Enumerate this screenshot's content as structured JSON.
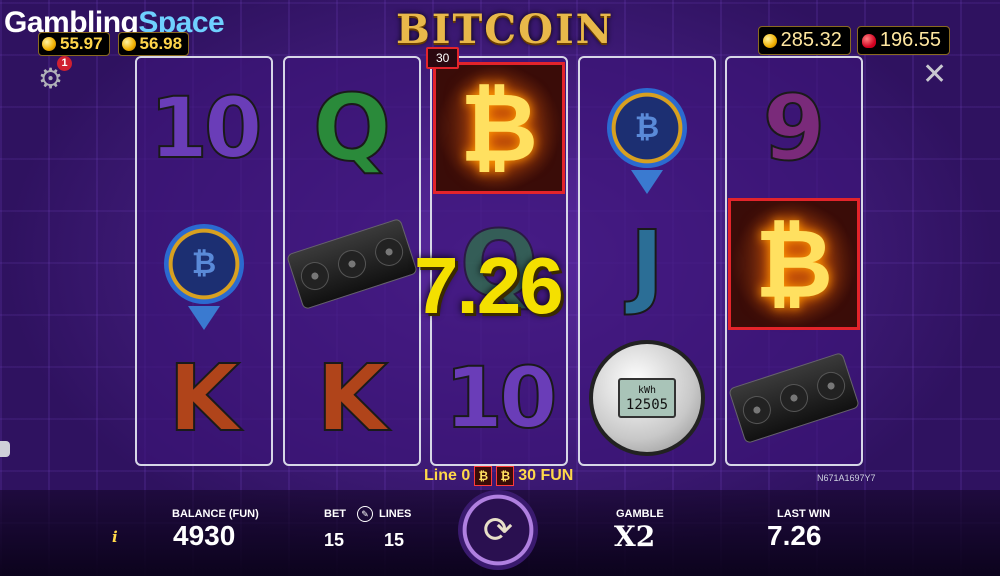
{
  "brand": {
    "name_part1": "Gambling",
    "name_part2": "Space"
  },
  "top_left_wallets": [
    {
      "icon": "gold-coin-icon",
      "value": "55.97"
    },
    {
      "icon": "gold-coin-icon",
      "value": "56.98"
    }
  ],
  "top_right_wallets": [
    {
      "icon": "gold-coin-icon",
      "value": "285.32"
    },
    {
      "icon": "strawberry-icon",
      "value": "196.55"
    }
  ],
  "settings": {
    "notification_count": "1"
  },
  "game_logo": "BITCOIN",
  "win_badge": "30",
  "reels": [
    [
      "10",
      "bitcoin-chip",
      "K"
    ],
    [
      "Q",
      "gpu-card",
      "K"
    ],
    [
      "bitcoin-gold",
      "Q",
      "10"
    ],
    [
      "bitcoin-chip",
      "J",
      "power-meter"
    ],
    [
      "9",
      "bitcoin-gold",
      "gpu-card"
    ]
  ],
  "meter": {
    "unit": "kWh",
    "reading": "12505"
  },
  "big_win_amount": "7.26",
  "line_info": {
    "prefix": "Line 0",
    "amount": "30 FUN"
  },
  "game_code": "N671A1697Y7",
  "bottom": {
    "balance_label": "BALANCE (FUN)",
    "balance_value": "4930",
    "bet_label": "BET",
    "bet_value": "15",
    "lines_label": "LINES",
    "lines_value": "15",
    "gamble_label": "GAMBLE",
    "gamble_value": "X2",
    "last_win_label": "LAST WIN",
    "last_win_value": "7.26"
  },
  "colors": {
    "accent_yellow": "#f4e000",
    "win_frame": "#e3242b",
    "background": "#3a1a6e"
  }
}
